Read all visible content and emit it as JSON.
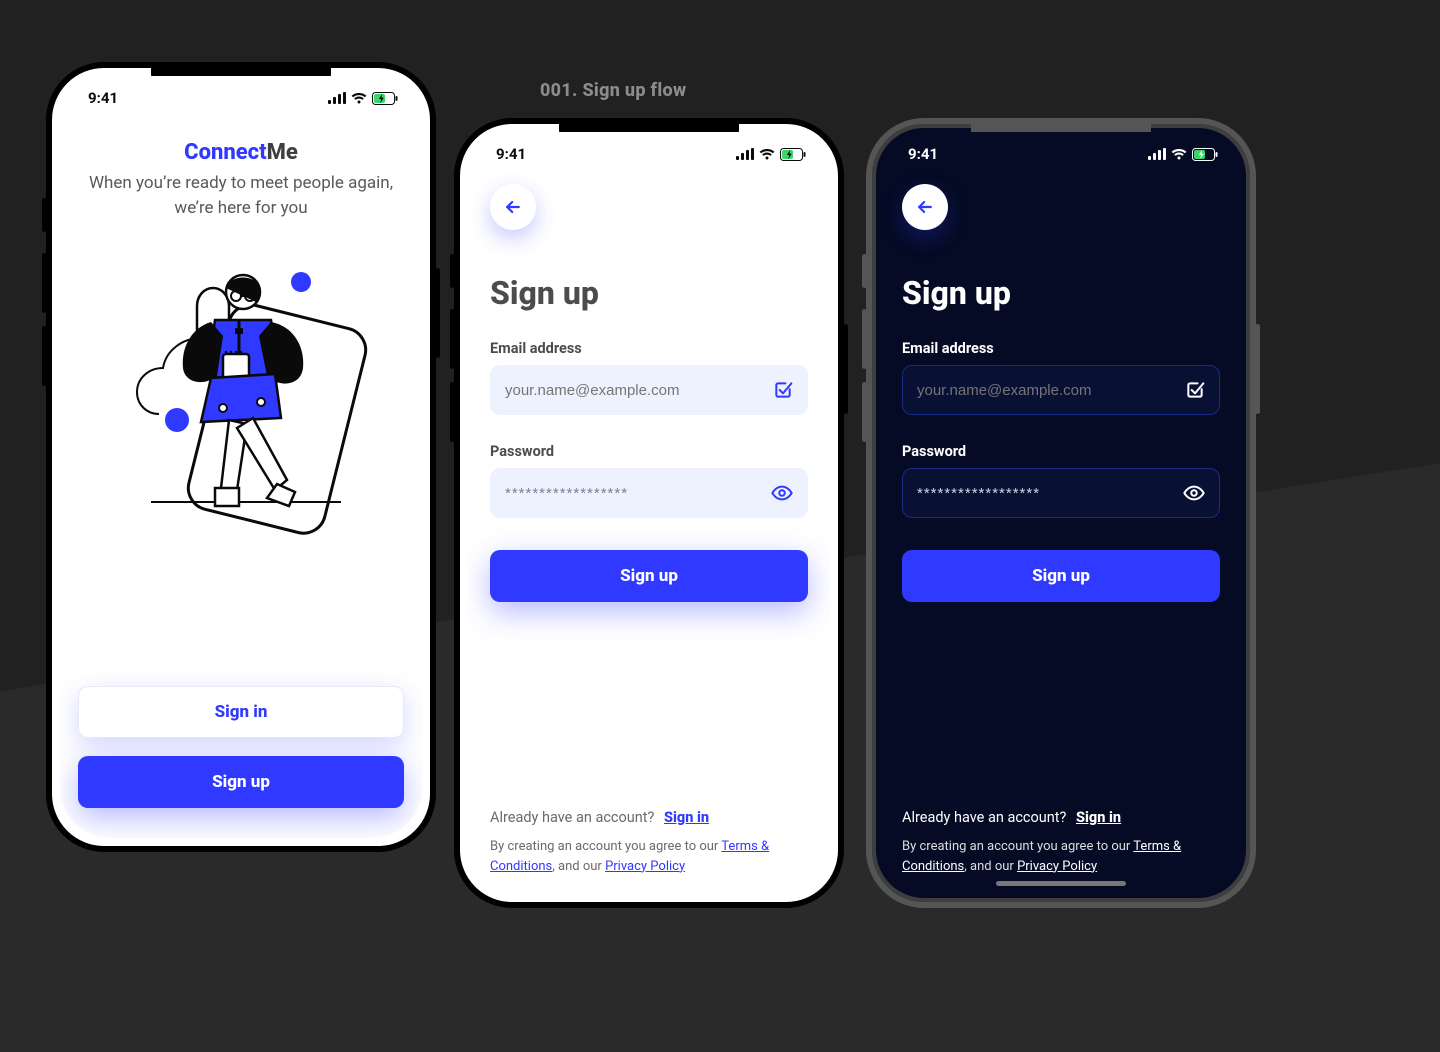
{
  "canvas": {
    "title": "001. Sign up flow"
  },
  "status": {
    "time": "9:41"
  },
  "colors": {
    "primary": "#2f39ff",
    "inputBgLight": "#eef2ff",
    "darkBg": "#050b24"
  },
  "screen1": {
    "brand_a": "Connect",
    "brand_b": "Me",
    "tagline": "When you’re ready to meet people again, we’re here for you",
    "signin_label": "Sign in",
    "signup_label": "Sign up"
  },
  "signup": {
    "heading": "Sign up",
    "email_label": "Email address",
    "email_placeholder": "your.name@example.com",
    "password_label": "Password",
    "password_value": "******************",
    "submit_label": "Sign up",
    "already_text": "Already have an account?",
    "signin_link": "Sign in",
    "legal_pre": "By creating an account you  agree to our ",
    "terms_link": "Terms & Conditions",
    "legal_mid": ", and our ",
    "privacy_link": "Privacy Policy"
  }
}
